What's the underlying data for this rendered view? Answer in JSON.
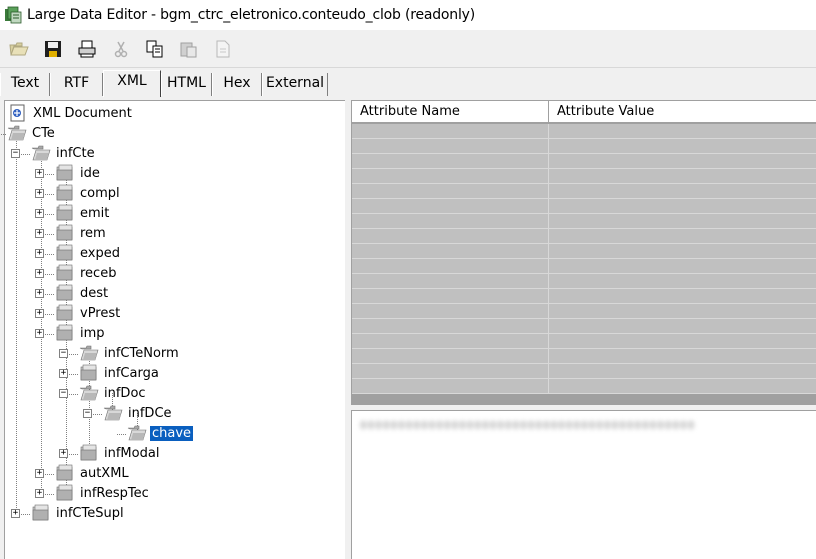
{
  "window": {
    "title": "Large Data Editor - bgm_ctrc_eletronico.conteudo_clob (readonly)"
  },
  "toolbar": {
    "buttons": [
      "open-icon",
      "save-icon",
      "print-icon",
      "cut-icon",
      "copy-icon",
      "paste-icon",
      "new-icon"
    ]
  },
  "tabs": [
    {
      "label": "Text"
    },
    {
      "label": "RTF"
    },
    {
      "label": "XML"
    },
    {
      "label": "HTML"
    },
    {
      "label": "Hex"
    },
    {
      "label": "External"
    }
  ],
  "active_tab": "XML",
  "tree": {
    "root": "XML Document",
    "nodes": [
      {
        "label": "CTe",
        "expanded": true
      },
      {
        "label": "infCte",
        "expanded": true
      },
      {
        "label": "ide",
        "expanded": false
      },
      {
        "label": "compl",
        "expanded": false
      },
      {
        "label": "emit",
        "expanded": false
      },
      {
        "label": "rem",
        "expanded": false
      },
      {
        "label": "exped",
        "expanded": false
      },
      {
        "label": "receb",
        "expanded": false
      },
      {
        "label": "dest",
        "expanded": false
      },
      {
        "label": "vPrest",
        "expanded": false
      },
      {
        "label": "imp",
        "expanded": false
      },
      {
        "label": "infCTeNorm",
        "expanded": true
      },
      {
        "label": "infCarga",
        "expanded": false
      },
      {
        "label": "infDoc",
        "expanded": true
      },
      {
        "label": "infDCe",
        "expanded": true
      },
      {
        "label": "chave",
        "selected": true
      },
      {
        "label": "infModal",
        "expanded": false
      },
      {
        "label": "autXML",
        "expanded": false
      },
      {
        "label": "infRespTec",
        "expanded": false
      },
      {
        "label": "infCTeSupl",
        "expanded": false
      }
    ]
  },
  "attributes_grid": {
    "columns": [
      "Attribute Name",
      "Attribute Value"
    ],
    "rows": []
  },
  "value_box": {
    "text": "00000000000000000000000000000000000000000000"
  }
}
